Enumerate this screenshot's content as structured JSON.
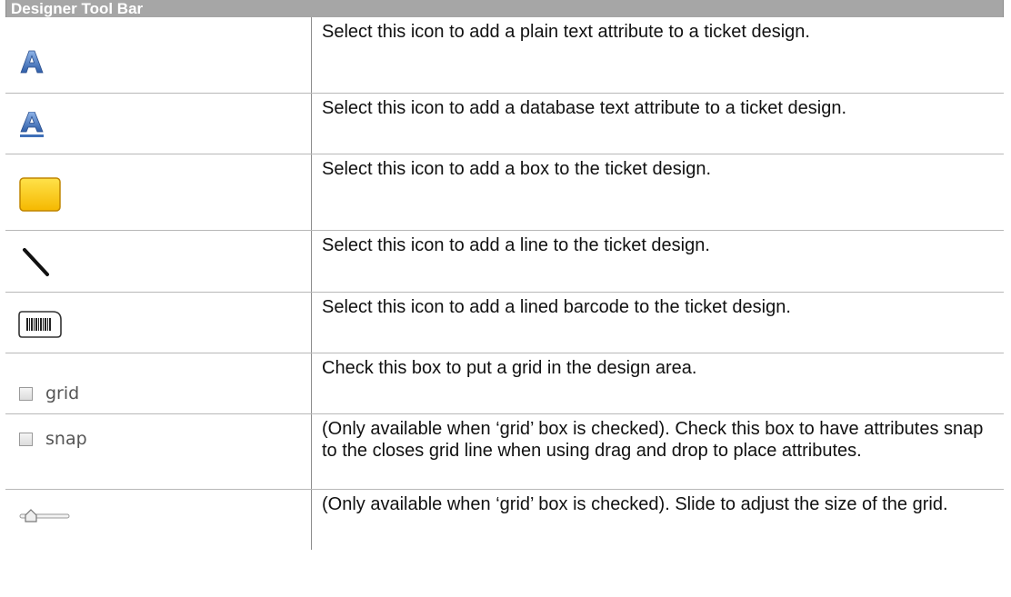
{
  "header": {
    "title": "Designer Tool Bar"
  },
  "rows": [
    {
      "icon": "plain-text-a-icon",
      "description": "Select this icon to add a plain text attribute to a ticket design."
    },
    {
      "icon": "database-text-a-icon",
      "description": "Select this icon to add a database text attribute to a ticket design."
    },
    {
      "icon": "box-icon",
      "description": "Select this icon to add a box to the ticket design."
    },
    {
      "icon": "line-icon",
      "description": "Select this icon to add a line to the ticket design."
    },
    {
      "icon": "barcode-icon",
      "description": "Select this icon to add a lined barcode to the ticket design."
    },
    {
      "icon": "grid-checkbox",
      "label": "grid",
      "description": "Check this box to put a grid in the design area."
    },
    {
      "icon": "snap-checkbox",
      "label": "snap",
      "description": "(Only available when ‘grid’ box is checked). Check this box to have attributes snap to the closes grid line when using drag and drop to place attributes."
    },
    {
      "icon": "slider-icon",
      "description": "(Only available when ‘grid’ box is checked). Slide to adjust the size of the grid."
    }
  ],
  "colors": {
    "header_bg": "#a6a6a6",
    "box_fill": "#ffd200",
    "a_icon_blue": "#3f6fb8"
  }
}
